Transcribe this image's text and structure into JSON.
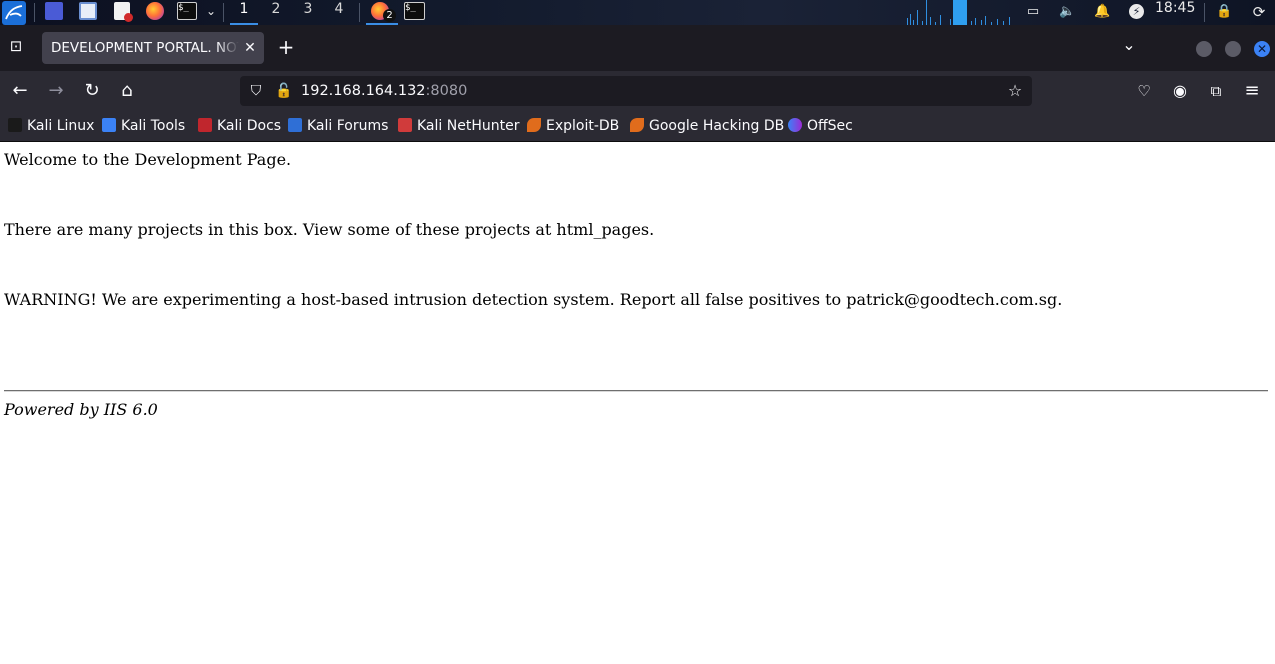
{
  "taskbar": {
    "workspaces": [
      "1",
      "2",
      "3",
      "4"
    ],
    "active_workspace": "1",
    "firefox_badge": "2",
    "clock": "18:45"
  },
  "browser": {
    "tab_title": "DEVELOPMENT PORTAL. NOT FOR OUTSIDERS OR HACKERS!",
    "url_host": "192.168.164.132",
    "url_port": ":8080"
  },
  "bookmarks": [
    {
      "label": "Kali Linux",
      "color": "#2a2a2a"
    },
    {
      "label": "Kali Tools",
      "color": "#3b82f6"
    },
    {
      "label": "Kali Docs",
      "color": "#c0262d"
    },
    {
      "label": "Kali Forums",
      "color": "#2f6fd6"
    },
    {
      "label": "Kali NetHunter",
      "color": "#d03b3b"
    },
    {
      "label": "Exploit-DB",
      "color": "#e06c1c"
    },
    {
      "label": "Google Hacking DB",
      "color": "#e06c1c"
    },
    {
      "label": "OffSec",
      "color": "#7b5cff"
    }
  ],
  "content": {
    "line1": "Welcome to the Development Page.",
    "line2": "There are many projects in this box. View some of these projects at html_pages.",
    "line3": "WARNING! We are experimenting a host-based intrusion detection system. Report all false positives to patrick@goodtech.com.sg.",
    "footer": "Powered by IIS 6.0"
  },
  "colors": {
    "accent": "#3b82f6",
    "tab_bg": "#42414d",
    "toolbar_bg": "#2b2a33"
  }
}
